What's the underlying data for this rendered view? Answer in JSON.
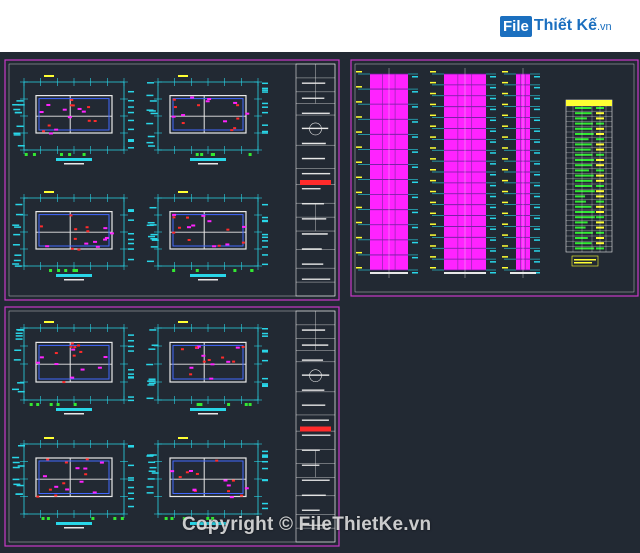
{
  "logo": {
    "box": "File",
    "name": "Thiết Kế",
    "suffix": ".vn"
  },
  "watermark": "Copyright © FileThietKe.vn",
  "colors": {
    "bg": "#222933",
    "frame": "#c839c8",
    "cyan": "#29d6e8",
    "magenta": "#ff23ff",
    "blue": "#4169ff",
    "yellow": "#ffff33",
    "green": "#33e833",
    "red": "#ff2b2b",
    "white": "#e8e8e8"
  },
  "icons": {
    "logo": "filethietke-logo-icon"
  }
}
